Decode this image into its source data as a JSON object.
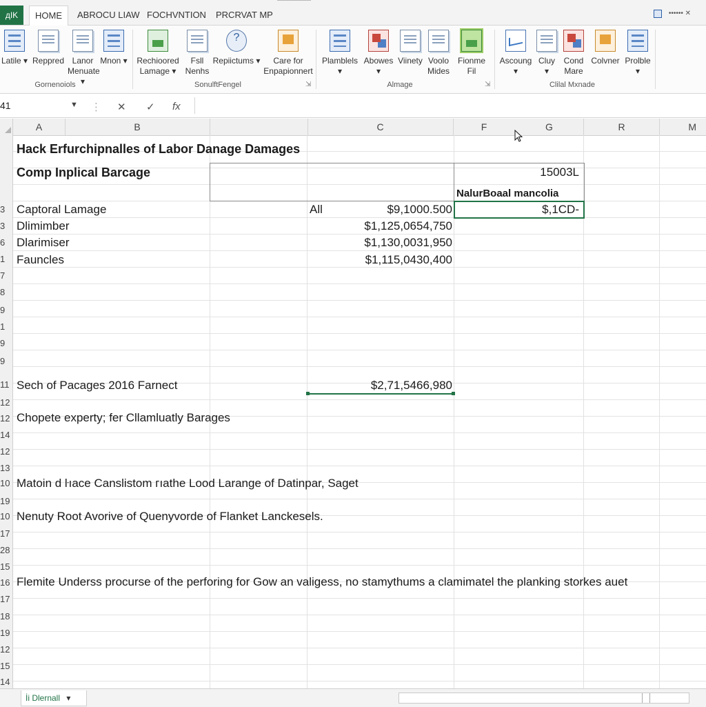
{
  "window": {
    "title": "––––––––",
    "account": "•••••• ✕"
  },
  "tabs": {
    "file": "дIK",
    "items": [
      "HOME",
      "ABROCU LIAW",
      "FOCHVNTION",
      "PRCRVAT MP"
    ]
  },
  "ribbon": {
    "buttons": [
      {
        "label": "Latile",
        "arrow": "▾"
      },
      {
        "label": "Reppred"
      },
      {
        "label": "Lanor Menuate",
        "arrow": "▾"
      },
      {
        "label": "Mnon",
        "arrow": "▾"
      },
      {
        "label": "Rechioored Lamage",
        "arrow": "▾"
      },
      {
        "label": "Fѕll Nenhs"
      },
      {
        "label": "Repiictums",
        "arrow": "▾"
      },
      {
        "label": "Care for Enpapionnert"
      },
      {
        "label": "Plamblels",
        "arrow": "▾"
      },
      {
        "label": "Abowes",
        "arrow": "▾"
      },
      {
        "label": "Viinety"
      },
      {
        "label": "Voolo Mides"
      },
      {
        "label": "Fionme Fil"
      },
      {
        "label": "Ascoung",
        "arrow": "▾"
      },
      {
        "label": "Cluy",
        "arrow": "▾"
      },
      {
        "label": "Cond Mare"
      },
      {
        "label": "Colvner"
      },
      {
        "label": "Prolble",
        "arrow": "▾"
      }
    ],
    "groups": [
      "Gornenoiols",
      "SonulftFengel",
      "Almage",
      "Clilal Mxnade"
    ],
    "launcher_glyph": "⇲"
  },
  "formula_bar": {
    "name_box": "41",
    "symbols": [
      "✕",
      "✓",
      "fx"
    ]
  },
  "grid": {
    "columns": [
      "A",
      "B",
      "C",
      "F",
      "G",
      "R",
      "M"
    ],
    "row_numbers": [
      "3",
      "3",
      "6",
      "1",
      "7",
      "8",
      "9",
      "1",
      "9",
      "9",
      "11",
      "12",
      "12",
      "14",
      "12",
      "13",
      "10",
      "19",
      "10",
      "17",
      "28",
      "15",
      "16",
      "17",
      "18",
      "19",
      "12",
      "15",
      "14"
    ],
    "title": "Hack Erfurchipnalles of Labor Danage Damages",
    "subtitle": "Comp Inplical Barcage",
    "g_header_value": "15003L",
    "g_header_label": "NalurBoaal mancolia",
    "rows": [
      {
        "label": "Captoral Lamage",
        "mid": "All",
        "amount": "$9,1000.500",
        "g": "$,1CD-"
      },
      {
        "label": "Dlimimber",
        "amount": "$1,125,0654,750"
      },
      {
        "label": "Dlarimiser",
        "amount": "$1,130,0031,950"
      },
      {
        "label": "Fauncles",
        "amount": "$1,115,0430,400"
      }
    ],
    "total_label": "Sech of Pacages 2016 Farnect",
    "total_amount": "$2,71,5466,980",
    "notes": [
      "Chopete experty; fer Cllamluatly Barages",
      "Matoin d ŀıace Canslistom гıathe Lood Larange of Datinpar, Saget",
      "Nenuty Root Avorive of Quenyvorde of Flanket Lanckesels.",
      "Flemite Underss procurse of the perforing for Gow an valigess, no stamythums a clamimatel the planking storkes auet"
    ]
  },
  "sheet": {
    "tab_label": "İі Dlernall",
    "tab_arrow": "▾"
  }
}
